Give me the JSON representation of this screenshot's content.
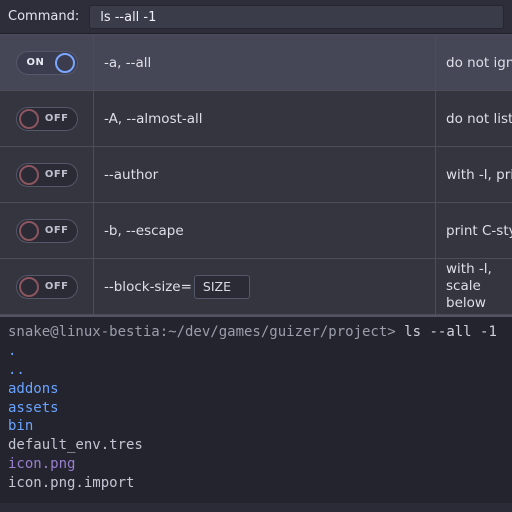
{
  "command": {
    "label": "Command:",
    "value": "ls --all -1"
  },
  "toggle_txt": {
    "on": "ON",
    "off": "OFF"
  },
  "options": [
    {
      "on": true,
      "flag": "-a, --all",
      "param": null,
      "desc": "do not ignore"
    },
    {
      "on": false,
      "flag": "-A, --almost-all",
      "param": null,
      "desc": "do not list im"
    },
    {
      "on": false,
      "flag": "--author",
      "param": null,
      "desc": "with -l, print t"
    },
    {
      "on": false,
      "flag": "-b, --escape",
      "param": null,
      "desc": "print C-style e"
    },
    {
      "on": false,
      "flag": "--block-size=",
      "param": "SIZE",
      "desc": "with -l, scale\nbelow"
    }
  ],
  "terminal": {
    "prompt": "snake@linux-bestia:~/dev/games/guizer/project>",
    "cmd": "ls --all -1",
    "lines": [
      {
        "cls": "dir",
        "text": "."
      },
      {
        "cls": "dir",
        "text": ".."
      },
      {
        "cls": "dir",
        "text": "addons"
      },
      {
        "cls": "dir",
        "text": "assets"
      },
      {
        "cls": "dir",
        "text": "bin"
      },
      {
        "cls": "fil",
        "text": "default_env.tres"
      },
      {
        "cls": "png",
        "text": "icon.png"
      },
      {
        "cls": "fil",
        "text": "icon.png.import"
      }
    ]
  }
}
